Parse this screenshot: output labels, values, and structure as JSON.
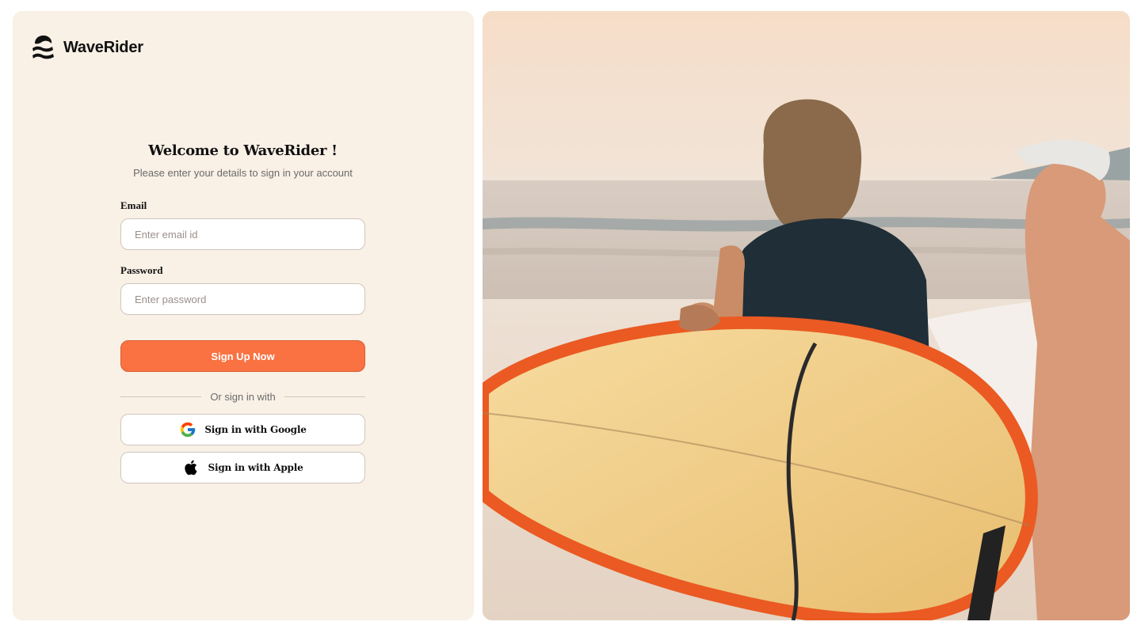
{
  "brand": {
    "name": "WaveRider",
    "logo_icon": "wave-icon"
  },
  "login": {
    "title": "Welcome to WaveRider !",
    "subtitle": "Please enter your details to sign in your account",
    "email": {
      "label": "Email",
      "placeholder": "Enter email id",
      "value": ""
    },
    "password": {
      "label": "Password",
      "placeholder": "Enter password",
      "value": ""
    },
    "submit_label": "Sign Up Now",
    "divider_text": "Or sign in with",
    "social": {
      "google": {
        "label": "Sign in with Google",
        "icon": "google-icon"
      },
      "apple": {
        "label": "Sign in with Apple",
        "icon": "apple-icon"
      }
    }
  },
  "hero_image": {
    "icon": "surfers-photo"
  },
  "colors": {
    "panel_background": "#f9f0e6",
    "accent": "#fa7242",
    "text": "#111111",
    "muted_text": "#6b6b6b",
    "border": "#cfc6bd"
  }
}
